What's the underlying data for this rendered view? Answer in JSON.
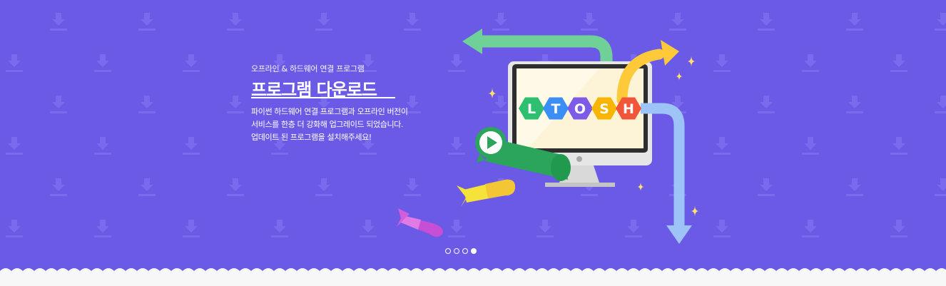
{
  "banner": {
    "background_color": "#6b5ae6",
    "pattern_color": "#7a6aee",
    "bottom_color": "#f7f7f7",
    "subtitle": "오프라인 & 하드웨어 연결 프로그램",
    "title": "프로그램 다운로드",
    "description": [
      "파이썬 하드웨어 연결 프로그램과 오프라인 버전이",
      "서비스를 한층 더 강화해 업그레이드 되었습니다.",
      "업데이트 된 프로그램을 설치해주세요!"
    ]
  },
  "illustration": {
    "logo_letters": [
      "L",
      "T",
      "O",
      "S",
      "H"
    ],
    "logo_colors": [
      "#2fbf71",
      "#3a8ef6",
      "#7b5be8",
      "#f7b500",
      "#f2553a"
    ],
    "icons": [
      "monitor-icon",
      "play-icon",
      "arrow-left-icon",
      "arrow-right-icon",
      "arrow-down-icon",
      "sparkle-icon"
    ]
  },
  "carousel": {
    "slide_count": 4,
    "active_index": 3
  }
}
